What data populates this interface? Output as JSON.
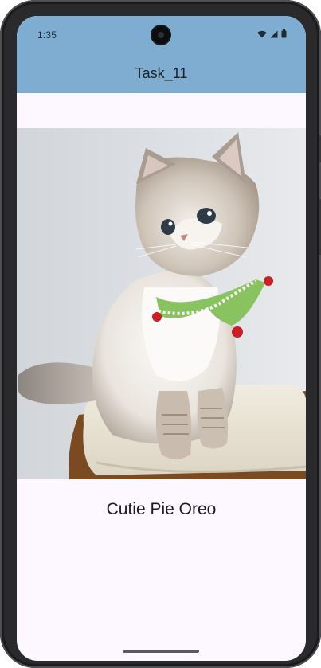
{
  "status_bar": {
    "time": "1:35",
    "icons": [
      "wifi-icon",
      "cellular-signal-icon",
      "battery-icon"
    ],
    "background": "#7fadd1"
  },
  "app_bar": {
    "title": "Task_11",
    "background": "#7fadd1"
  },
  "content": {
    "image": "photo of a fluffy cat wearing a knitted collar",
    "caption": "Cutie Pie Oreo",
    "background": "#fdf7ff"
  }
}
